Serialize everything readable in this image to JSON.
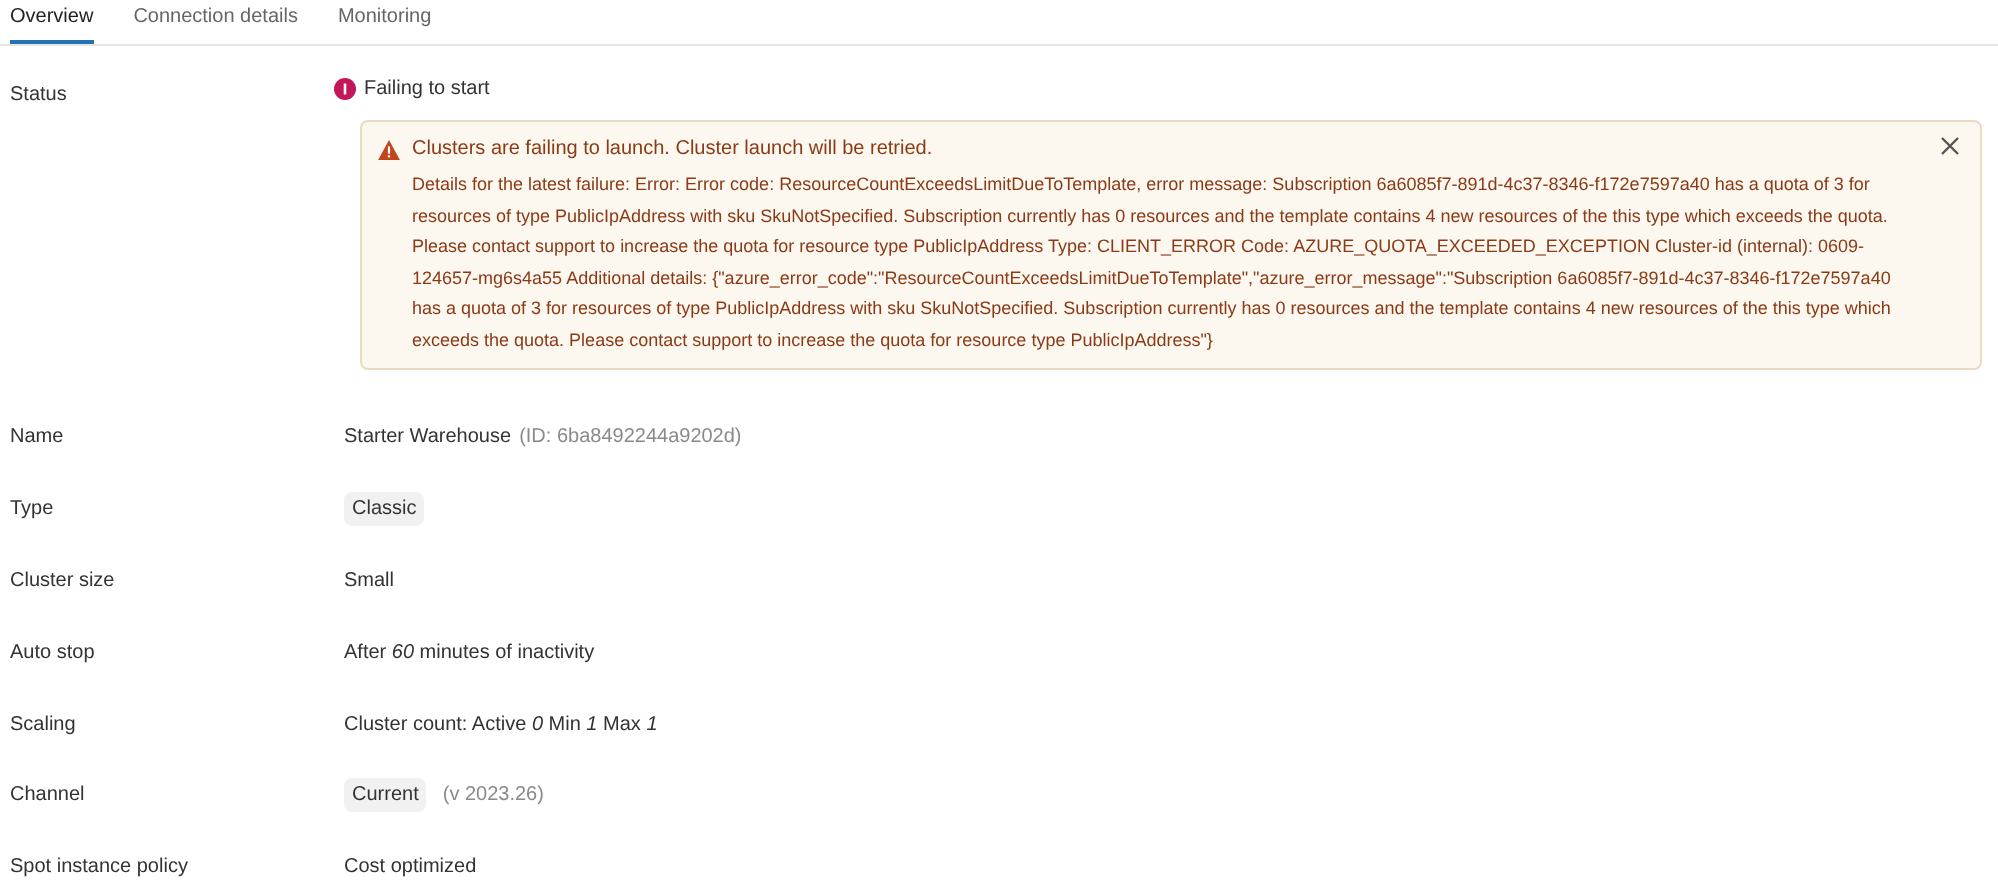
{
  "tabs": [
    {
      "label": "Overview",
      "selected": true
    },
    {
      "label": "Connection details",
      "selected": false
    },
    {
      "label": "Monitoring",
      "selected": false
    }
  ],
  "status": {
    "label": "Status",
    "value": "Failing to start",
    "alert": {
      "title": "Clusters are failing to launch. Cluster launch will be retried.",
      "message": "Details for the latest failure: Error: Error code: ResourceCountExceedsLimitDueToTemplate, error message: Subscription 6a6085f7-891d-4c37-8346-f172e7597a40 has a quota of 3 for resources of type PublicIpAddress with sku SkuNotSpecified. Subscription currently has 0 resources and the template contains 4 new resources of the this type which exceeds the quota. Please contact support to increase the quota for resource type PublicIpAddress Type: CLIENT_ERROR Code: AZURE_QUOTA_EXCEEDED_EXCEPTION Cluster-id (internal): 0609-124657-mg6s4a55 Additional details: {\"azure_error_code\":\"ResourceCountExceedsLimitDueToTemplate\",\"azure_error_message\":\"Subscription 6a6085f7-891d-4c37-8346-f172e7597a40 has a quota of 3 for resources of type PublicIpAddress with sku SkuNotSpecified. Subscription currently has 0 resources and the template contains 4 new resources of the this type which exceeds the quota. Please contact support to increase the quota for resource type PublicIpAddress\"}"
    }
  },
  "properties": [
    {
      "label": "Name",
      "kind": "text",
      "value": "Starter Warehouse",
      "suffix": "(ID: 6ba8492244a9202d)"
    },
    {
      "label": "Type",
      "kind": "tag",
      "value": "Classic"
    },
    {
      "label": "Cluster size",
      "kind": "text",
      "value": "Small"
    },
    {
      "label": "Auto stop",
      "kind": "text",
      "value": "After *60* minutes of inactivity"
    },
    {
      "label": "Scaling",
      "kind": "text",
      "value": "Cluster count: Active *0* Min *1* Max *1*"
    },
    {
      "label": "Channel",
      "kind": "tag",
      "value": "Current",
      "suffix": "(v 2023.26)"
    },
    {
      "label": "Spot instance policy",
      "kind": "text",
      "value": "Cost optimized"
    }
  ]
}
